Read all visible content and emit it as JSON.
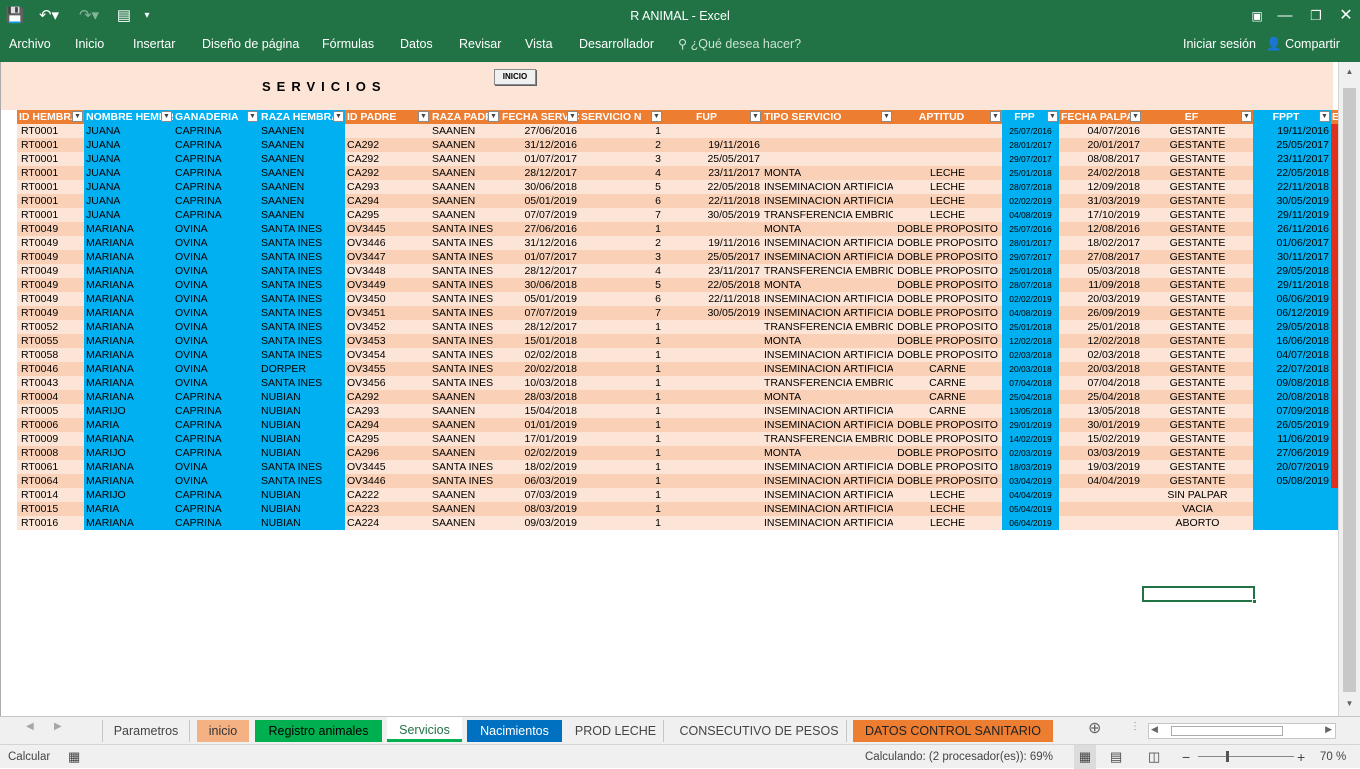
{
  "app": {
    "title": "R ANIMAL - Excel"
  },
  "ribbon": {
    "tabs": [
      "Archivo",
      "Inicio",
      "Insertar",
      "Diseño de página",
      "Fórmulas",
      "Datos",
      "Revisar",
      "Vista",
      "Desarrollador"
    ],
    "tell_me": "¿Qué desea hacer?",
    "sign_in": "Iniciar sesión",
    "share": "Compartir"
  },
  "sheet": {
    "banner_title": "SERVICIOS",
    "inicio_button": "INICIO",
    "headers": [
      "ID HEMBRA",
      "NOMBRE HEMBRA",
      "GANADERIA",
      "RAZA HEMBRA",
      "ID PADRE",
      "RAZA PADRE",
      "FECHA SERVICIO",
      "SERVICIO N",
      "FUP",
      "TIPO SERVICIO",
      "APTITUD",
      "FPP",
      "FECHA PALPACION",
      "EF",
      "FPPT",
      "E"
    ],
    "rows": [
      [
        "RT0001",
        "JUANA",
        "CAPRINA",
        "SAANEN",
        "",
        "SAANEN",
        "27/06/2016",
        "1",
        "",
        "",
        "",
        "25/07/2016",
        "04/07/2016",
        "GESTANTE",
        "19/11/2016"
      ],
      [
        "RT0001",
        "JUANA",
        "CAPRINA",
        "SAANEN",
        "CA292",
        "SAANEN",
        "31/12/2016",
        "2",
        "19/11/2016",
        "",
        "",
        "28/01/2017",
        "20/01/2017",
        "GESTANTE",
        "25/05/2017"
      ],
      [
        "RT0001",
        "JUANA",
        "CAPRINA",
        "SAANEN",
        "CA292",
        "SAANEN",
        "01/07/2017",
        "3",
        "25/05/2017",
        "",
        "",
        "29/07/2017",
        "08/08/2017",
        "GESTANTE",
        "23/11/2017"
      ],
      [
        "RT0001",
        "JUANA",
        "CAPRINA",
        "SAANEN",
        "CA292",
        "SAANEN",
        "28/12/2017",
        "4",
        "23/11/2017",
        "MONTA",
        "LECHE",
        "25/01/2018",
        "24/02/2018",
        "GESTANTE",
        "22/05/2018"
      ],
      [
        "RT0001",
        "JUANA",
        "CAPRINA",
        "SAANEN",
        "CA293",
        "SAANEN",
        "30/06/2018",
        "5",
        "22/05/2018",
        "INSEMINACION ARTIFICIAL",
        "LECHE",
        "28/07/2018",
        "12/09/2018",
        "GESTANTE",
        "22/11/2018"
      ],
      [
        "RT0001",
        "JUANA",
        "CAPRINA",
        "SAANEN",
        "CA294",
        "SAANEN",
        "05/01/2019",
        "6",
        "22/11/2018",
        "INSEMINACION ARTIFICIAL",
        "LECHE",
        "02/02/2019",
        "31/03/2019",
        "GESTANTE",
        "30/05/2019"
      ],
      [
        "RT0001",
        "JUANA",
        "CAPRINA",
        "SAANEN",
        "CA295",
        "SAANEN",
        "07/07/2019",
        "7",
        "30/05/2019",
        "TRANSFERENCIA EMBRIONARIA",
        "LECHE",
        "04/08/2019",
        "17/10/2019",
        "GESTANTE",
        "29/11/2019"
      ],
      [
        "RT0049",
        "MARIANA",
        "OVINA",
        "SANTA INES",
        "OV3445",
        "SANTA INES",
        "27/06/2016",
        "1",
        "",
        "MONTA",
        "DOBLE PROPOSITO",
        "25/07/2016",
        "12/08/2016",
        "GESTANTE",
        "26/11/2016"
      ],
      [
        "RT0049",
        "MARIANA",
        "OVINA",
        "SANTA INES",
        "OV3446",
        "SANTA INES",
        "31/12/2016",
        "2",
        "19/11/2016",
        "INSEMINACION ARTIFICIAL",
        "DOBLE PROPOSITO",
        "28/01/2017",
        "18/02/2017",
        "GESTANTE",
        "01/06/2017"
      ],
      [
        "RT0049",
        "MARIANA",
        "OVINA",
        "SANTA INES",
        "OV3447",
        "SANTA INES",
        "01/07/2017",
        "3",
        "25/05/2017",
        "INSEMINACION ARTIFICIAL",
        "DOBLE PROPOSITO",
        "29/07/2017",
        "27/08/2017",
        "GESTANTE",
        "30/11/2017"
      ],
      [
        "RT0049",
        "MARIANA",
        "OVINA",
        "SANTA INES",
        "OV3448",
        "SANTA INES",
        "28/12/2017",
        "4",
        "23/11/2017",
        "TRANSFERENCIA EMBRIONARIA",
        "DOBLE PROPOSITO",
        "25/01/2018",
        "05/03/2018",
        "GESTANTE",
        "29/05/2018"
      ],
      [
        "RT0049",
        "MARIANA",
        "OVINA",
        "SANTA INES",
        "OV3449",
        "SANTA INES",
        "30/06/2018",
        "5",
        "22/05/2018",
        "MONTA",
        "DOBLE PROPOSITO",
        "28/07/2018",
        "11/09/2018",
        "GESTANTE",
        "29/11/2018"
      ],
      [
        "RT0049",
        "MARIANA",
        "OVINA",
        "SANTA INES",
        "OV3450",
        "SANTA INES",
        "05/01/2019",
        "6",
        "22/11/2018",
        "INSEMINACION ARTIFICIAL",
        "DOBLE PROPOSITO",
        "02/02/2019",
        "20/03/2019",
        "GESTANTE",
        "06/06/2019"
      ],
      [
        "RT0049",
        "MARIANA",
        "OVINA",
        "SANTA INES",
        "OV3451",
        "SANTA INES",
        "07/07/2019",
        "7",
        "30/05/2019",
        "INSEMINACION ARTIFICIAL",
        "DOBLE PROPOSITO",
        "04/08/2019",
        "26/09/2019",
        "GESTANTE",
        "06/12/2019"
      ],
      [
        "RT0052",
        "MARIANA",
        "OVINA",
        "SANTA INES",
        "OV3452",
        "SANTA INES",
        "28/12/2017",
        "1",
        "",
        "TRANSFERENCIA EMBRIONARIA",
        "DOBLE PROPOSITO",
        "25/01/2018",
        "25/01/2018",
        "GESTANTE",
        "29/05/2018"
      ],
      [
        "RT0055",
        "MARIANA",
        "OVINA",
        "SANTA INES",
        "OV3453",
        "SANTA INES",
        "15/01/2018",
        "1",
        "",
        "MONTA",
        "DOBLE PROPOSITO",
        "12/02/2018",
        "12/02/2018",
        "GESTANTE",
        "16/06/2018"
      ],
      [
        "RT0058",
        "MARIANA",
        "OVINA",
        "SANTA INES",
        "OV3454",
        "SANTA INES",
        "02/02/2018",
        "1",
        "",
        "INSEMINACION ARTIFICIAL",
        "DOBLE PROPOSITO",
        "02/03/2018",
        "02/03/2018",
        "GESTANTE",
        "04/07/2018"
      ],
      [
        "RT0046",
        "MARIANA",
        "OVINA",
        "DORPER",
        "OV3455",
        "SANTA INES",
        "20/02/2018",
        "1",
        "",
        "INSEMINACION ARTIFICIAL",
        "CARNE",
        "20/03/2018",
        "20/03/2018",
        "GESTANTE",
        "22/07/2018"
      ],
      [
        "RT0043",
        "MARIANA",
        "OVINA",
        "SANTA INES",
        "OV3456",
        "SANTA INES",
        "10/03/2018",
        "1",
        "",
        "TRANSFERENCIA EMBRIONARIA",
        "CARNE",
        "07/04/2018",
        "07/04/2018",
        "GESTANTE",
        "09/08/2018"
      ],
      [
        "RT0004",
        "MARIANA",
        "CAPRINA",
        "NUBIAN",
        "CA292",
        "SAANEN",
        "28/03/2018",
        "1",
        "",
        "MONTA",
        "CARNE",
        "25/04/2018",
        "25/04/2018",
        "GESTANTE",
        "20/08/2018"
      ],
      [
        "RT0005",
        "MARIJO",
        "CAPRINA",
        "NUBIAN",
        "CA293",
        "SAANEN",
        "15/04/2018",
        "1",
        "",
        "INSEMINACION ARTIFICIAL",
        "CARNE",
        "13/05/2018",
        "13/05/2018",
        "GESTANTE",
        "07/09/2018"
      ],
      [
        "RT0006",
        "MARIA",
        "CAPRINA",
        "NUBIAN",
        "CA294",
        "SAANEN",
        "01/01/2019",
        "1",
        "",
        "INSEMINACION ARTIFICIAL",
        "DOBLE PROPOSITO",
        "29/01/2019",
        "30/01/2019",
        "GESTANTE",
        "26/05/2019"
      ],
      [
        "RT0009",
        "MARIANA",
        "CAPRINA",
        "NUBIAN",
        "CA295",
        "SAANEN",
        "17/01/2019",
        "1",
        "",
        "TRANSFERENCIA EMBRIONARIA",
        "DOBLE PROPOSITO",
        "14/02/2019",
        "15/02/2019",
        "GESTANTE",
        "11/06/2019"
      ],
      [
        "RT0008",
        "MARIJO",
        "CAPRINA",
        "NUBIAN",
        "CA296",
        "SAANEN",
        "02/02/2019",
        "1",
        "",
        "MONTA",
        "DOBLE PROPOSITO",
        "02/03/2019",
        "03/03/2019",
        "GESTANTE",
        "27/06/2019"
      ],
      [
        "RT0061",
        "MARIANA",
        "OVINA",
        "SANTA INES",
        "OV3445",
        "SANTA INES",
        "18/02/2019",
        "1",
        "",
        "INSEMINACION ARTIFICIAL",
        "DOBLE PROPOSITO",
        "18/03/2019",
        "19/03/2019",
        "GESTANTE",
        "20/07/2019"
      ],
      [
        "RT0064",
        "MARIANA",
        "OVINA",
        "SANTA INES",
        "OV3446",
        "SANTA INES",
        "06/03/2019",
        "1",
        "",
        "INSEMINACION ARTIFICIAL",
        "DOBLE PROPOSITO",
        "03/04/2019",
        "04/04/2019",
        "GESTANTE",
        "05/08/2019"
      ],
      [
        "RT0014",
        "MARIJO",
        "CAPRINA",
        "NUBIAN",
        "CA222",
        "SAANEN",
        "07/03/2019",
        "1",
        "",
        "INSEMINACION ARTIFICIAL",
        "LECHE",
        "04/04/2019",
        "",
        "SIN PALPAR",
        ""
      ],
      [
        "RT0015",
        "MARIA",
        "CAPRINA",
        "NUBIAN",
        "CA223",
        "SAANEN",
        "08/03/2019",
        "1",
        "",
        "INSEMINACION ARTIFICIAL",
        "LECHE",
        "05/04/2019",
        "",
        "VACIA",
        ""
      ],
      [
        "RT0016",
        "MARIANA",
        "CAPRINA",
        "NUBIAN",
        "CA224",
        "SAANEN",
        "09/03/2019",
        "1",
        "",
        "INSEMINACION ARTIFICIAL",
        "LECHE",
        "06/04/2019",
        "",
        "ABORTO",
        ""
      ]
    ]
  },
  "sheet_tabs": [
    "Parametros",
    "inicio",
    "Registro animales",
    "Servicios",
    "Nacimientos",
    "PROD LECHE",
    "CONSECUTIVO DE PESOS",
    "DATOS CONTROL SANITARIO"
  ],
  "status": {
    "mode": "Calcular",
    "calc": "Calculando: (2 procesador(es)): 69%",
    "zoom": "70 %"
  },
  "colors": {
    "excel_green": "#217346",
    "header_orange": "#ed7d31",
    "header_blue": "#00b0f0",
    "row_peach": "#fad1b6",
    "row_blue": "#00b0f0",
    "flag_red": "#e0301e"
  }
}
